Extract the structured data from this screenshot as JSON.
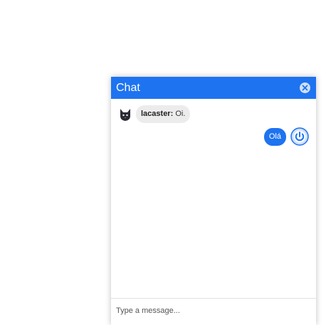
{
  "chat": {
    "title": "Chat",
    "close_icon": "close-circle-icon",
    "accent_color": "#1e73f0"
  },
  "messages": {
    "incoming": {
      "username": "lacaster:",
      "text": "Oi.",
      "avatar_icon": "cat-avatar-icon"
    },
    "outgoing": {
      "text": "Olá",
      "avatar_icon": "power-avatar-icon"
    }
  },
  "composer": {
    "placeholder": "Type a message..."
  }
}
